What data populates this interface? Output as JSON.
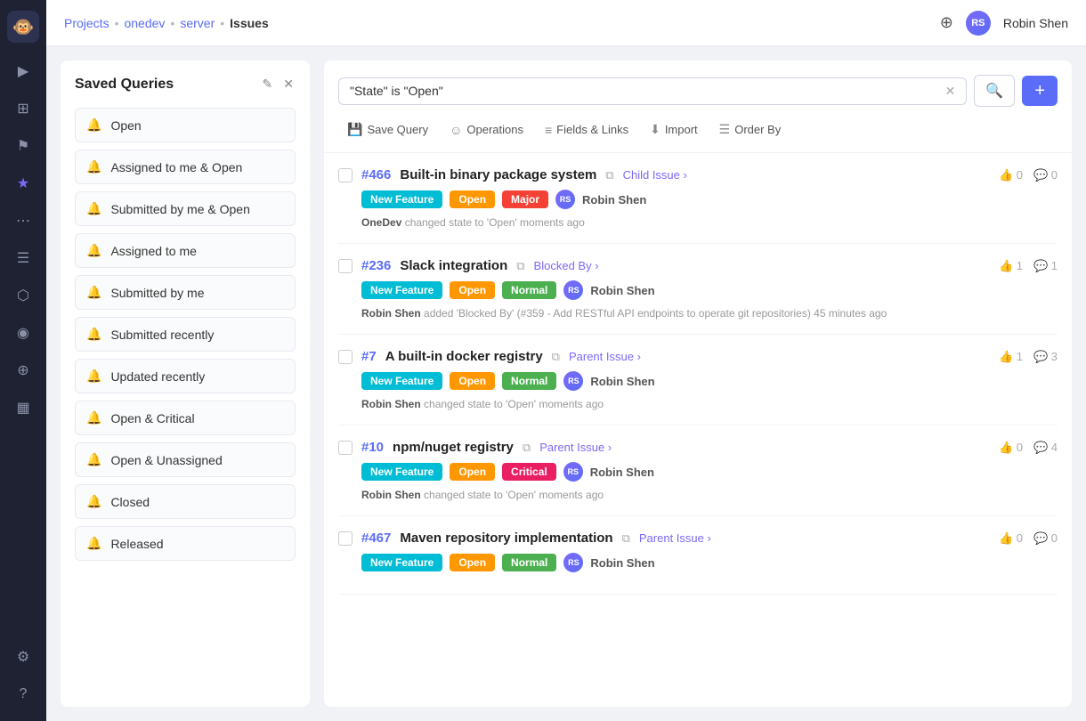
{
  "nav": {
    "logo_text": "🐵",
    "icons": [
      "▶",
      "⊞",
      "⚙",
      "◎",
      "⋯",
      "☰",
      "◉",
      "⬡",
      "⊕",
      "?"
    ]
  },
  "header": {
    "breadcrumb": [
      "Projects",
      "onedev",
      "server",
      "Issues"
    ],
    "user_name": "Robin Shen",
    "user_initials": "RS",
    "github_icon": "⊕"
  },
  "saved_queries": {
    "title": "Saved Queries",
    "edit_icon": "✎",
    "close_icon": "✕",
    "items": [
      {
        "label": "Open"
      },
      {
        "label": "Assigned to me & Open"
      },
      {
        "label": "Submitted by me & Open"
      },
      {
        "label": "Assigned to me"
      },
      {
        "label": "Submitted by me"
      },
      {
        "label": "Submitted recently"
      },
      {
        "label": "Updated recently"
      },
      {
        "label": "Open & Critical"
      },
      {
        "label": "Open & Unassigned"
      },
      {
        "label": "Closed"
      },
      {
        "label": "Released"
      }
    ]
  },
  "search": {
    "value": "\"State\" is \"Open\"",
    "placeholder": "\"State\" is \"Open\"",
    "clear_icon": "✕",
    "search_icon": "🔍",
    "add_icon": "+"
  },
  "toolbar": {
    "save_query": "Save Query",
    "operations": "Operations",
    "fields_links": "Fields & Links",
    "import": "Import",
    "order_by": "Order By"
  },
  "issues": [
    {
      "id": "#466",
      "title": "Built-in binary package system",
      "link_label": "Child Issue",
      "link_icon": "›",
      "tags": [
        {
          "label": "New Feature",
          "class": "tag-new-feature"
        },
        {
          "label": "Open",
          "class": "tag-open"
        },
        {
          "label": "Major",
          "class": "tag-major"
        }
      ],
      "user": "Robin Shen",
      "activity": "OneDev changed state to 'Open' moments ago",
      "activity_actor": "OneDev",
      "activity_rest": "changed state to 'Open' moments ago",
      "votes": 0,
      "comments": 0
    },
    {
      "id": "#236",
      "title": "Slack integration",
      "link_label": "Blocked By",
      "link_icon": "›",
      "tags": [
        {
          "label": "New Feature",
          "class": "tag-new-feature"
        },
        {
          "label": "Open",
          "class": "tag-open"
        },
        {
          "label": "Normal",
          "class": "tag-normal"
        }
      ],
      "user": "Robin Shen",
      "activity": "Robin Shen added 'Blocked By' (#359 - Add RESTful API endpoints to operate git repositories) 45 minutes ago",
      "activity_actor": "Robin Shen",
      "activity_rest": "added 'Blocked By' (#359 - Add RESTful API endpoints to operate git repositories) 45 minutes ago",
      "votes": 1,
      "comments": 1
    },
    {
      "id": "#7",
      "title": "A built-in docker registry",
      "link_label": "Parent Issue",
      "link_icon": "›",
      "tags": [
        {
          "label": "New Feature",
          "class": "tag-new-feature"
        },
        {
          "label": "Open",
          "class": "tag-open"
        },
        {
          "label": "Normal",
          "class": "tag-normal"
        }
      ],
      "user": "Robin Shen",
      "activity": "Robin Shen changed state to 'Open' moments ago",
      "activity_actor": "Robin Shen",
      "activity_rest": "changed state to 'Open' moments ago",
      "votes": 1,
      "comments": 3
    },
    {
      "id": "#10",
      "title": "npm/nuget registry",
      "link_label": "Parent Issue",
      "link_icon": "›",
      "tags": [
        {
          "label": "New Feature",
          "class": "tag-new-feature"
        },
        {
          "label": "Open",
          "class": "tag-open"
        },
        {
          "label": "Critical",
          "class": "tag-critical"
        }
      ],
      "user": "Robin Shen",
      "activity": "Robin Shen changed state to 'Open' moments ago",
      "activity_actor": "Robin Shen",
      "activity_rest": "changed state to 'Open' moments ago",
      "votes": 0,
      "comments": 4
    },
    {
      "id": "#467",
      "title": "Maven repository implementation",
      "link_label": "Parent Issue",
      "link_icon": "›",
      "tags": [
        {
          "label": "New Feature",
          "class": "tag-new-feature"
        },
        {
          "label": "Open",
          "class": "tag-open"
        },
        {
          "label": "Normal",
          "class": "tag-normal"
        }
      ],
      "user": "Robin Shen",
      "activity": "",
      "activity_actor": "",
      "activity_rest": "",
      "votes": 0,
      "comments": 0
    }
  ]
}
